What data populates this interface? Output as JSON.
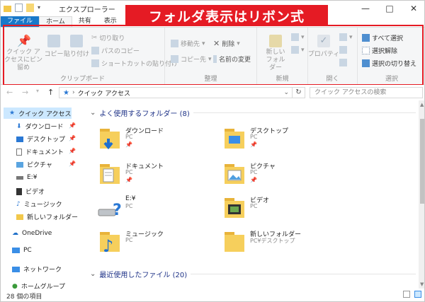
{
  "annotation": {
    "label": "フォルダ表示はリボン式",
    "color": "#e51b24"
  },
  "window": {
    "title": "エクスプローラー",
    "minimize": "—",
    "maximize": "□",
    "close": "✕"
  },
  "tabs": [
    "ファイル",
    "ホーム",
    "共有",
    "表示"
  ],
  "ribbon": {
    "clipboard": {
      "label": "クリップボード",
      "pin": "クイック アクセスにピン留め",
      "copy": "コピー",
      "paste": "貼り付け",
      "cut": "切り取り",
      "copy_path": "パスのコピー",
      "paste_shortcut": "ショートカットの貼り付け"
    },
    "organize": {
      "label": "整理",
      "move_to": "移動先",
      "copy_to": "コピー先",
      "delete": "削除",
      "rename": "名前の変更"
    },
    "new": {
      "label": "新規",
      "new_folder": "新しいフォルダー"
    },
    "open": {
      "label": "開く",
      "properties": "プロパティ"
    },
    "select": {
      "label": "選択",
      "select_all": "すべて選択",
      "select_none": "選択解除",
      "invert": "選択の切り替え"
    }
  },
  "address": {
    "back": "←",
    "forward": "→",
    "up": "↑",
    "path": "クイック アクセス",
    "refresh": "↻",
    "search_placeholder": "クイック アクセスの検索"
  },
  "nav": {
    "quick_access": "クイック アクセス",
    "items": [
      "ダウンロード",
      "デスクトップ",
      "ドキュメント",
      "ピクチャ",
      "E:¥",
      "ビデオ",
      "ミュージック",
      "新しいフォルダー"
    ],
    "onedrive": "OneDrive",
    "pc": "PC",
    "network": "ネットワーク",
    "homegroup": "ホームグループ"
  },
  "frequent": {
    "header": "よく使用するフォルダー (8)",
    "folders": [
      {
        "name": "ダウンロード",
        "sub": "PC"
      },
      {
        "name": "デスクトップ",
        "sub": "PC"
      },
      {
        "name": "ドキュメント",
        "sub": "PC"
      },
      {
        "name": "ピクチャ",
        "sub": "PC"
      },
      {
        "name": "E:¥",
        "sub": "PC"
      },
      {
        "name": "ビデオ",
        "sub": "PC"
      },
      {
        "name": "ミュージック",
        "sub": "PC"
      },
      {
        "name": "新しいフォルダー",
        "sub": "PC¥デスクトップ"
      }
    ]
  },
  "recent": {
    "header": "最近使用したファイル (20)"
  },
  "status": {
    "count": "28 個の項目"
  }
}
